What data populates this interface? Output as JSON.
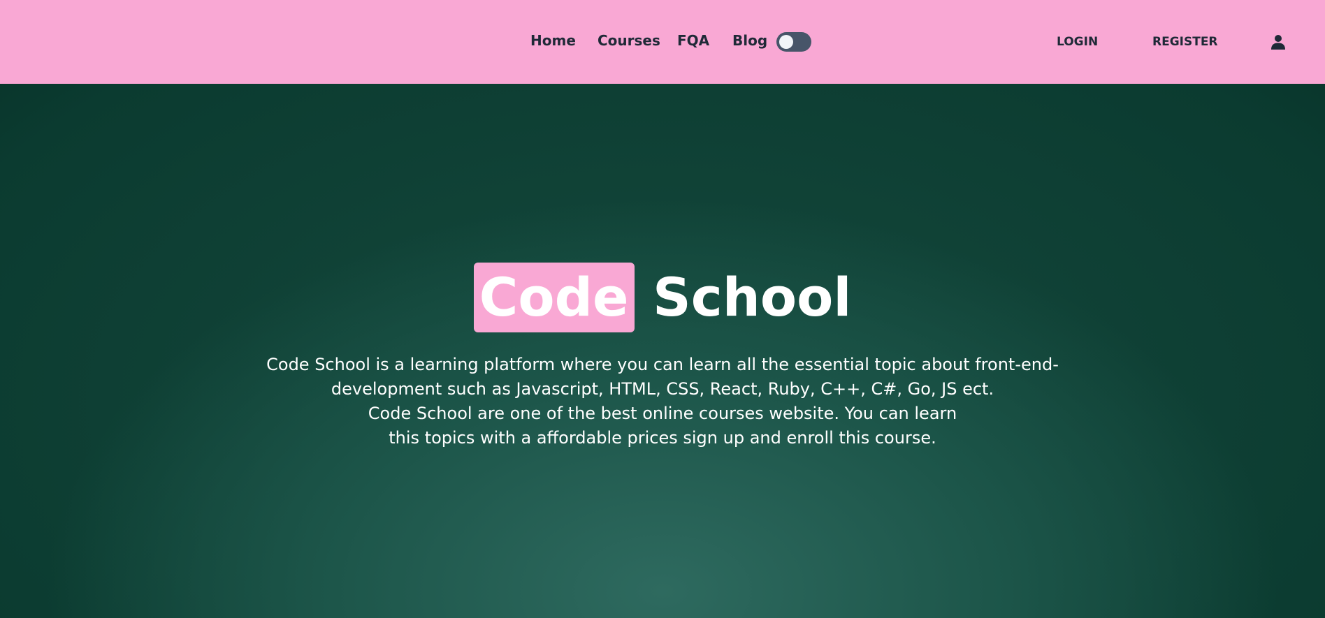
{
  "nav": {
    "links": [
      {
        "label": "Home"
      },
      {
        "label": "Courses"
      },
      {
        "label": "FQA"
      },
      {
        "label": "Blog"
      }
    ],
    "theme_toggle_on": false,
    "login_label": "LOGIN",
    "register_label": "REGISTER",
    "user_icon": "user-icon"
  },
  "hero": {
    "title_highlight": "Code",
    "title_rest": "School",
    "description_lines": [
      "Code School is a learning platform where you can learn all the essential topic about front-end-",
      "development such as Javascript, HTML, CSS, React, Ruby, C++, C#, Go, JS ect.",
      "Code School are one of the best online courses website. You can learn",
      "this topics with a affordable prices sign up and enroll this course."
    ]
  },
  "colors": {
    "navbar_bg": "#f9a8d4",
    "hero_bg": "#0b3b30",
    "highlight": "#f9a8d4"
  }
}
